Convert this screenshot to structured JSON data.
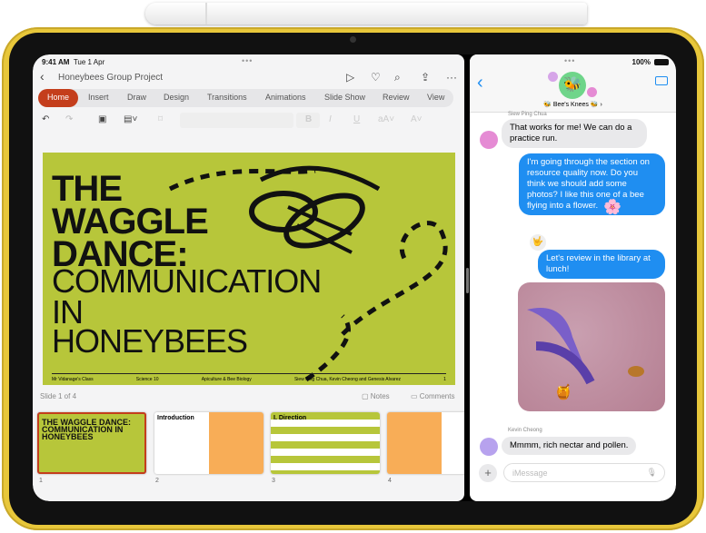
{
  "status": {
    "time": "9:41 AM",
    "date": "Tue 1 Apr",
    "battery": "100%"
  },
  "ppt": {
    "doc_title": "Honeybees Group Project",
    "tabs": [
      "Home",
      "Insert",
      "Draw",
      "Design",
      "Transitions",
      "Animations",
      "Slide Show",
      "Review",
      "View"
    ],
    "active_tab": "Home",
    "accent": "#c43e1c",
    "slide": {
      "line1": "THE",
      "line2": "WAGGLE",
      "line3": "DANCE:",
      "line4": "COMMUNICATION",
      "line5": "IN",
      "line6": "HONEYBEES",
      "footer": [
        "Mr Vidanage's Class",
        "Science 10",
        "Apiculture & Bee Biology",
        "Siew Ping Chua, Kevin Cheong and Genesis Alvarez",
        "1"
      ]
    },
    "slide_counter": "Slide 1 of 4",
    "notes": "Notes",
    "comments": "Comments",
    "thumbnails": [
      {
        "num": "1",
        "title": "THE WAGGLE DANCE: COMMUNICATION IN HONEYBEES"
      },
      {
        "num": "2",
        "title": "Introduction"
      },
      {
        "num": "3",
        "title": "I. Direction"
      },
      {
        "num": "4",
        "title": ""
      }
    ]
  },
  "messages": {
    "group_name": "Bee's Knees",
    "thread": [
      {
        "sender": "Siew Ping Chua",
        "dir": "in",
        "text": "That works for me! We can do a practice run."
      },
      {
        "dir": "out",
        "text": "I'm going through the section on resource quality now. Do you think we should add some photos? I like this one of a bee flying into a flower."
      },
      {
        "dir": "out",
        "text": "Let's review in the library at lunch!"
      },
      {
        "sender": "Kevin Cheong",
        "dir": "in",
        "text": "Mmmm, rich nectar and pollen."
      }
    ],
    "input_placeholder": "iMessage",
    "accent": "#1f8ef1"
  }
}
